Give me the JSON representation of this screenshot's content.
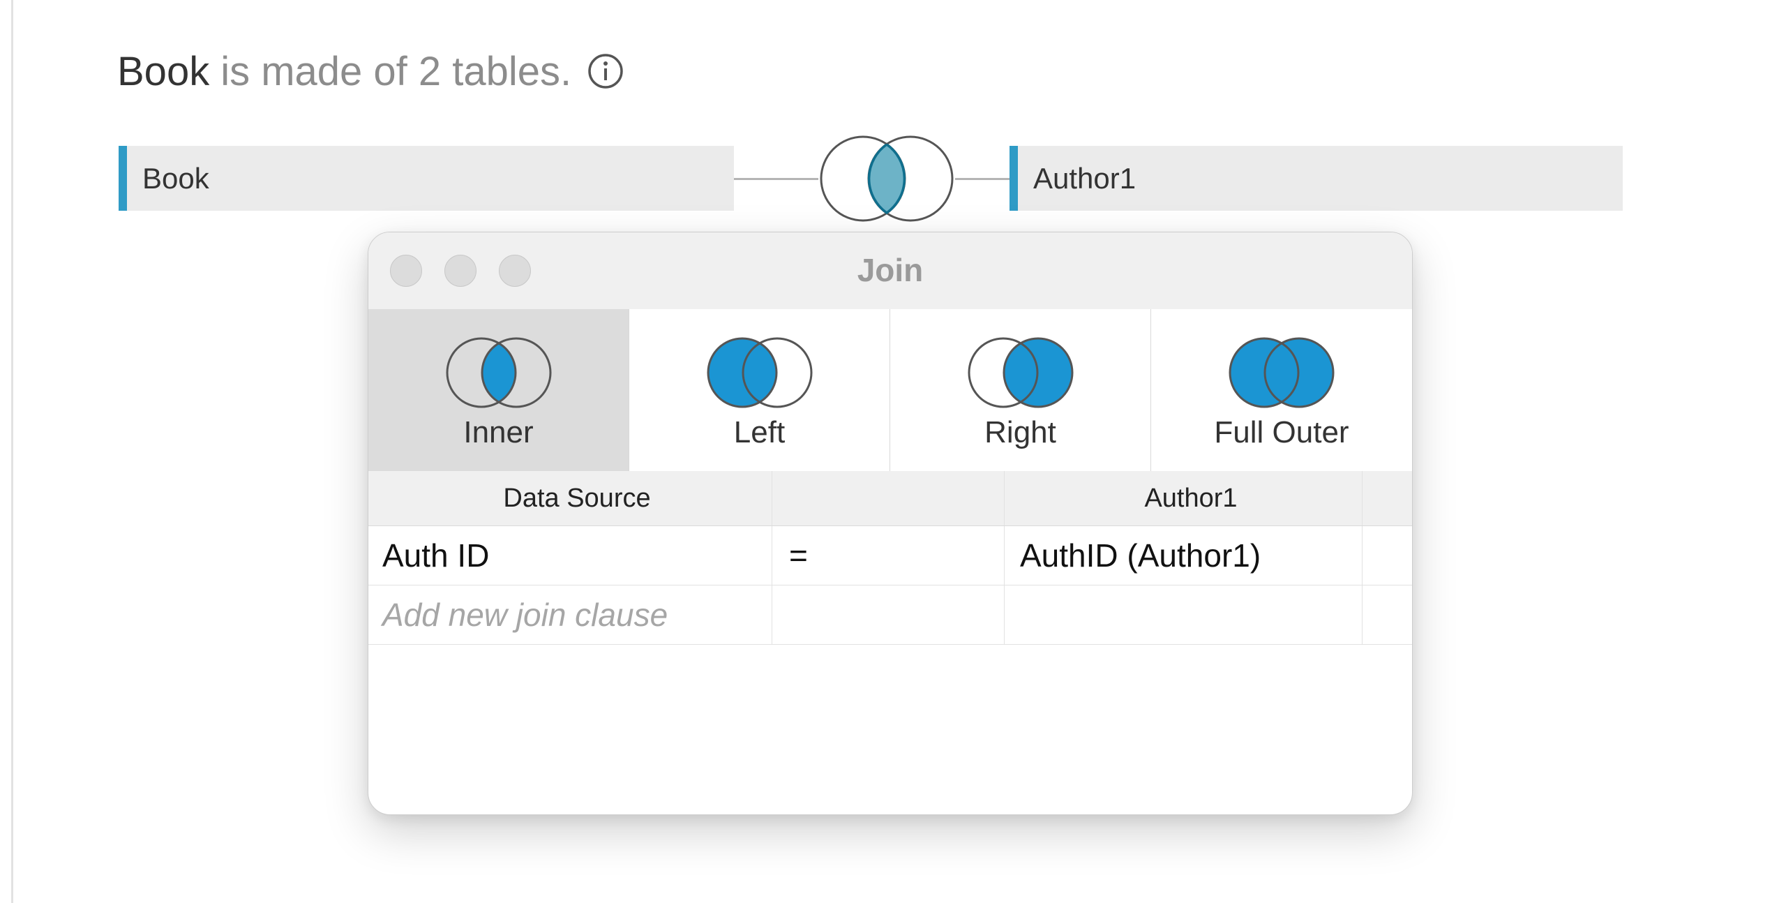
{
  "header": {
    "table_name": "Book",
    "description": "is made of 2 tables."
  },
  "tables": {
    "left": "Book",
    "right": "Author1"
  },
  "join_dialog": {
    "title": "Join",
    "join_types": [
      {
        "label": "Inner",
        "selected": true
      },
      {
        "label": "Left",
        "selected": false
      },
      {
        "label": "Right",
        "selected": false
      },
      {
        "label": "Full Outer",
        "selected": false
      }
    ],
    "columns": {
      "left": "Data Source",
      "operator": "",
      "right": "Author1"
    },
    "clauses": [
      {
        "left": "Auth ID",
        "operator": "=",
        "right": "AuthID (Author1)"
      }
    ],
    "add_clause_placeholder": "Add new join clause"
  },
  "colors": {
    "accent": "#2f9bc6",
    "join_fill": "#1b95d3",
    "main_join_fill": "#6db3c7"
  }
}
